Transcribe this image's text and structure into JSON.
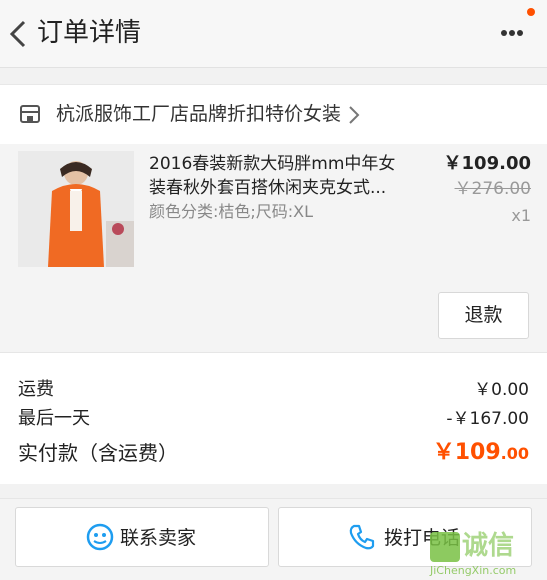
{
  "header": {
    "title": "订单详情",
    "back_icon": "chevron-left-icon",
    "more_icon": "more-dots-icon",
    "notification_color": "#ff5000"
  },
  "shop": {
    "icon": "store-icon",
    "name": "杭派服饰工厂店品牌折扣特价女装"
  },
  "item": {
    "title": "2016春装新款大码胖mm中年女装春秋外套百搭休闲夹克女式...",
    "sku": "颜色分类:桔色;尺码:XL",
    "price": "￥109.00",
    "original_price": "￥276.00",
    "quantity": "x1",
    "refund_label": "退款"
  },
  "summary": {
    "shipping_label": "运费",
    "shipping_value": "￥0.00",
    "discount_label": "最后一天",
    "discount_value": "-￥167.00",
    "total_label": "实付款（含运费）",
    "total_main": "￥109",
    "total_cents": ".00",
    "accent_color": "#ff5000"
  },
  "actions": {
    "contact_label": "联系卖家",
    "call_label": "拨打电话"
  },
  "watermark": {
    "text": "诚信",
    "sub": "JiChengXin.com"
  }
}
